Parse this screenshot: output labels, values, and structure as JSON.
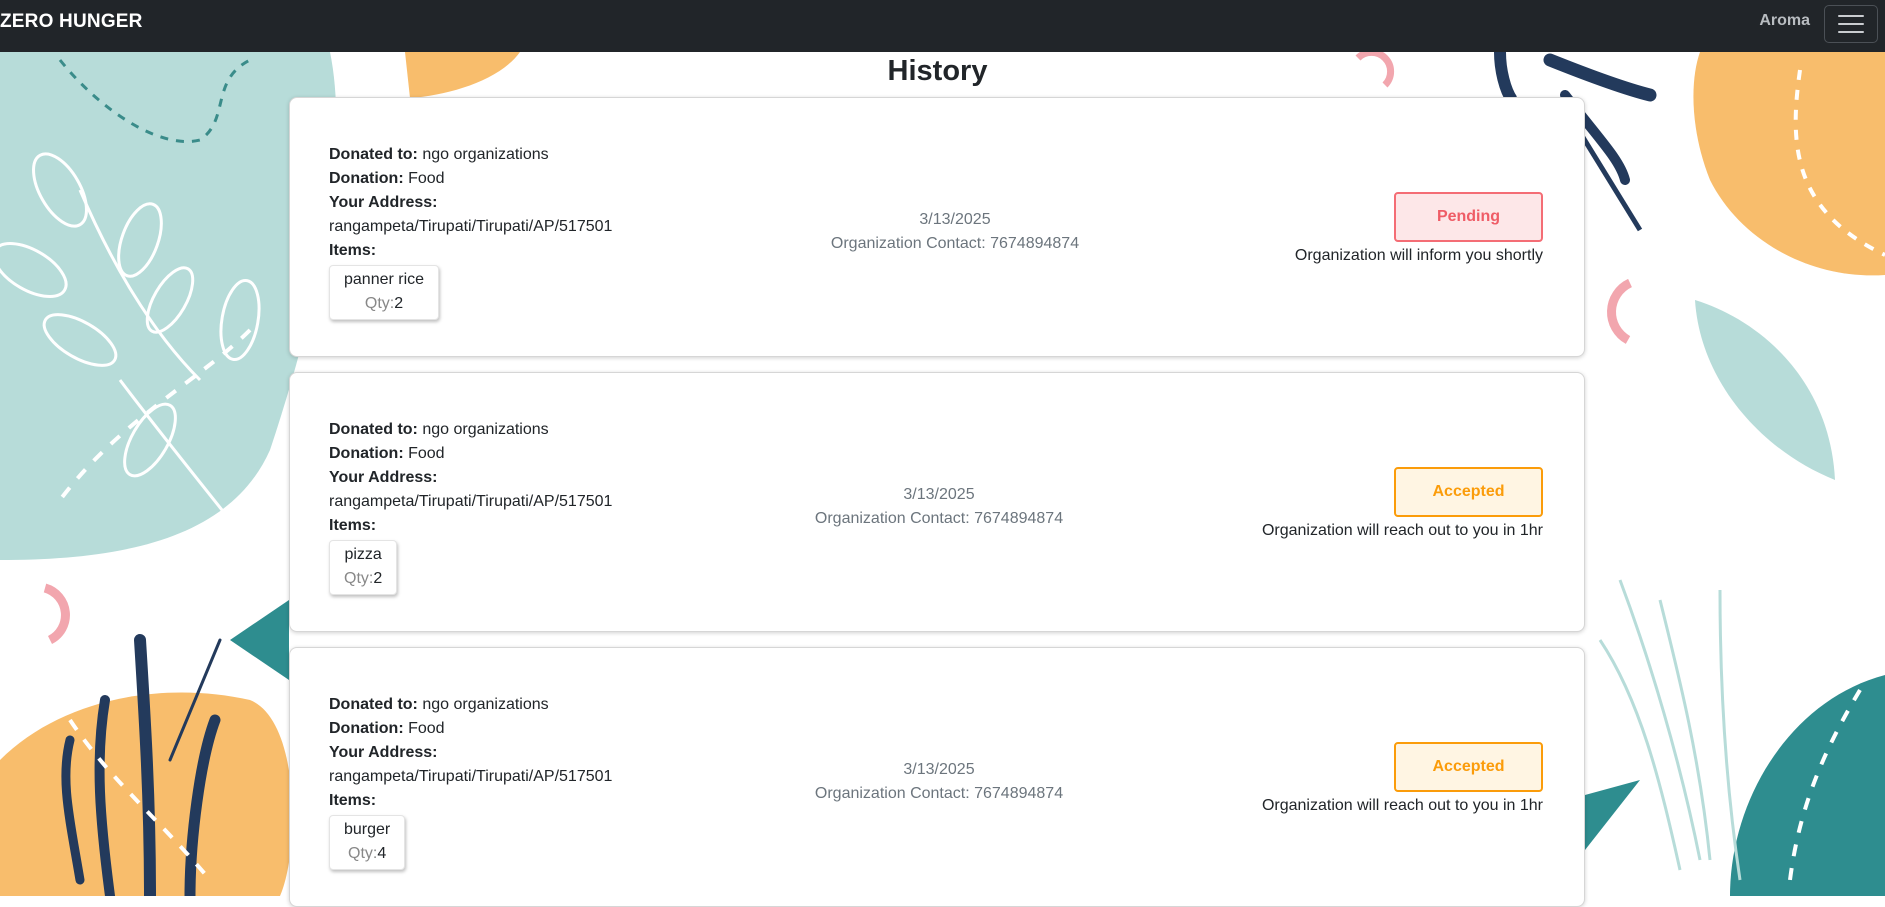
{
  "navbar": {
    "brand": "ZERO HUNGER",
    "user": "Aroma",
    "menu_icon": "hamburger-menu-icon"
  },
  "page": {
    "title": "History"
  },
  "labels": {
    "donated_to": "Donated to:",
    "donation": "Donation:",
    "address": "Your Address:",
    "items": "Items:",
    "qty": "Qty:"
  },
  "colors": {
    "navbar": "#212529",
    "pending": "#f46d75",
    "accepted": "#fb9c0a"
  },
  "donations": [
    {
      "donated_to": "ngo organizations",
      "donation": "Food",
      "address": "rangampeta/Tirupati/Tirupati/AP/517501",
      "item_name": "panner rice",
      "item_qty": "2",
      "date": "3/13/2025",
      "contact": "Organization Contact: 7674894874",
      "status": "Pending",
      "status_note": "Organization will inform you shortly"
    },
    {
      "donated_to": "ngo organizations",
      "donation": "Food",
      "address": "rangampeta/Tirupati/Tirupati/AP/517501",
      "item_name": "pizza",
      "item_qty": "2",
      "date": "3/13/2025",
      "contact": "Organization Contact: 7674894874",
      "status": "Accepted",
      "status_note": "Organization will reach out to you in 1hr"
    },
    {
      "donated_to": "ngo organizations",
      "donation": "Food",
      "address": "rangampeta/Tirupati/Tirupati/AP/517501",
      "item_name": "burger",
      "item_qty": "4",
      "date": "3/13/2025",
      "contact": "Organization Contact: 7674894874",
      "status": "Accepted",
      "status_note": "Organization will reach out to you in 1hr"
    }
  ]
}
